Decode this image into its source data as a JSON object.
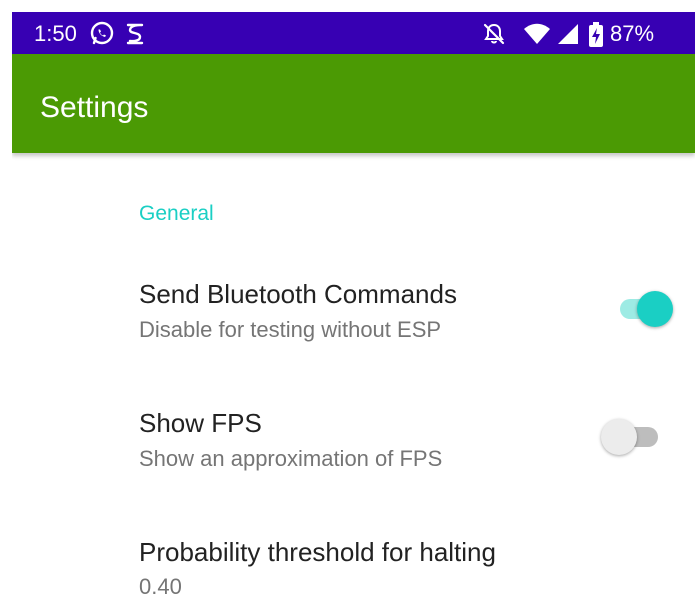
{
  "status_bar": {
    "time": "1:50",
    "battery_percent": "87%",
    "left_icons": [
      "whatsapp-icon",
      "notification-s-icon"
    ],
    "right_icons": [
      "bell-off-icon",
      "wifi-icon",
      "cell-signal-icon",
      "battery-charging-icon"
    ]
  },
  "app_bar": {
    "title": "Settings"
  },
  "settings": {
    "category": "General",
    "items": [
      {
        "title": "Send Bluetooth Commands",
        "summary": "Disable for testing without ESP",
        "toggle": true
      },
      {
        "title": "Show FPS",
        "summary": "Show an approximation of FPS",
        "toggle": false
      },
      {
        "title": "Probability threshold for halting",
        "summary": "0.40"
      }
    ]
  },
  "colors": {
    "status_bar": "#3700B3",
    "app_bar": "#4B9A04",
    "accent": "#1ACFC4",
    "switch_on_track": "#9DEBE4",
    "switch_off_thumb": "#ECECEC",
    "switch_off_track": "#BDBDBD"
  }
}
